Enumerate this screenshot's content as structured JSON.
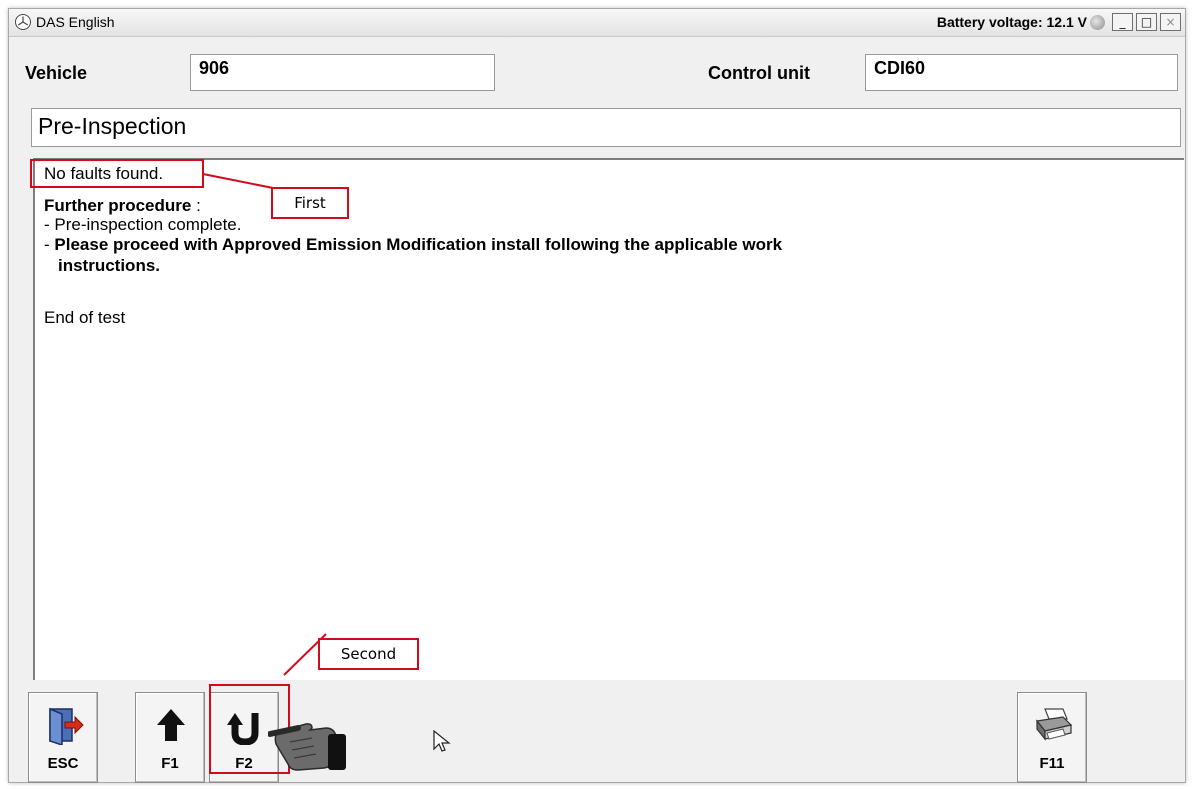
{
  "window": {
    "title": "DAS English",
    "battery_text": "Battery voltage: 12.1 V",
    "controls": {
      "minimize": "_",
      "maximize": "□",
      "close": "×"
    }
  },
  "header": {
    "vehicle_label": "Vehicle",
    "vehicle_value": "906",
    "control_unit_label": "Control unit",
    "control_unit_value": "CDI60"
  },
  "section_title": "Pre-Inspection",
  "content": {
    "status": "No faults found.",
    "further_label": "Further procedure",
    "further_suffix": " :",
    "step1": "- Pre-inspection complete.",
    "step2_dash": "- ",
    "step2_line1": "Please proceed with Approved Emission Modification install following the applicable work",
    "step2_line2": "instructions.",
    "end": "End of test"
  },
  "toolbar": {
    "esc": "ESC",
    "f1": "F1",
    "f2": "F2",
    "f11": "F11"
  },
  "annotations": {
    "first": "First",
    "second": "Second",
    "color": "#d10a1c"
  },
  "icons": {
    "esc": "exit-door-icon",
    "f1": "up-arrow-icon",
    "f2": "u-turn-icon",
    "f11": "printer-icon",
    "pointer": "hand-pointer-icon",
    "cursor": "mouse-cursor-icon"
  }
}
